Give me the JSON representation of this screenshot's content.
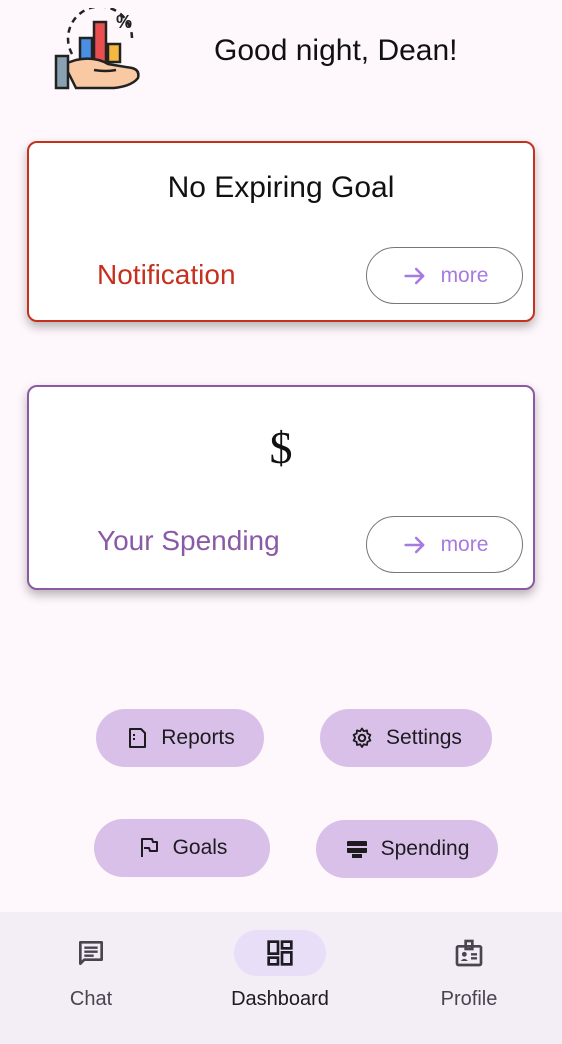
{
  "header": {
    "greeting": "Good night, Dean!",
    "logo_icon": "finance-hand-chart-icon"
  },
  "notification_card": {
    "title": "No Expiring Goal",
    "label": "Notification",
    "more_label": "more",
    "border_color": "#c6301f"
  },
  "spending_card": {
    "title": "$",
    "label": "Your Spending",
    "more_label": "more",
    "border_color": "#8a5aa6"
  },
  "actions": {
    "reports": "Reports",
    "settings": "Settings",
    "goals": "Goals",
    "spending": "Spending"
  },
  "bottom_nav": {
    "items": [
      {
        "label": "Chat",
        "icon": "chat-icon"
      },
      {
        "label": "Dashboard",
        "icon": "dashboard-icon",
        "selected": true
      },
      {
        "label": "Profile",
        "icon": "profile-badge-icon"
      }
    ]
  },
  "colors": {
    "accent": "#a77ae0",
    "pill_bg": "#d9c0e9",
    "nav_bg": "#f3edf6",
    "nav_active": "#e8def8"
  }
}
